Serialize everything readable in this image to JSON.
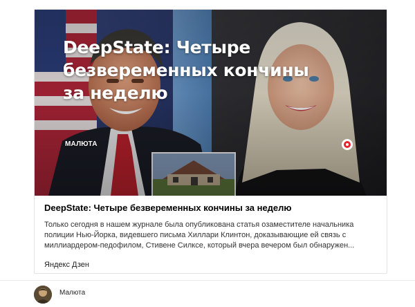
{
  "hero": {
    "title": "DeepState: Четыре безвеременных кончины за неделю",
    "source_label": "МАЛЮТА",
    "badge_icon": "zen-logo-icon",
    "accent": "#e4252d"
  },
  "article": {
    "title": "DeepState: Четыре безвеременных кончины за неделю",
    "text": "Только сегодня в нашем журнале была опубликована статья озаместителе начальника полиции Нью-Йорка, видевшего письма Хиллари Клинтон, доказывающие ей связь с миллиардером-педофилом, Стивене Силксе, который вчера вечером был обнаружен...",
    "source": "Яндекс Дзен"
  },
  "author": {
    "name": "Малюта",
    "avatar_icon": "avatar"
  }
}
